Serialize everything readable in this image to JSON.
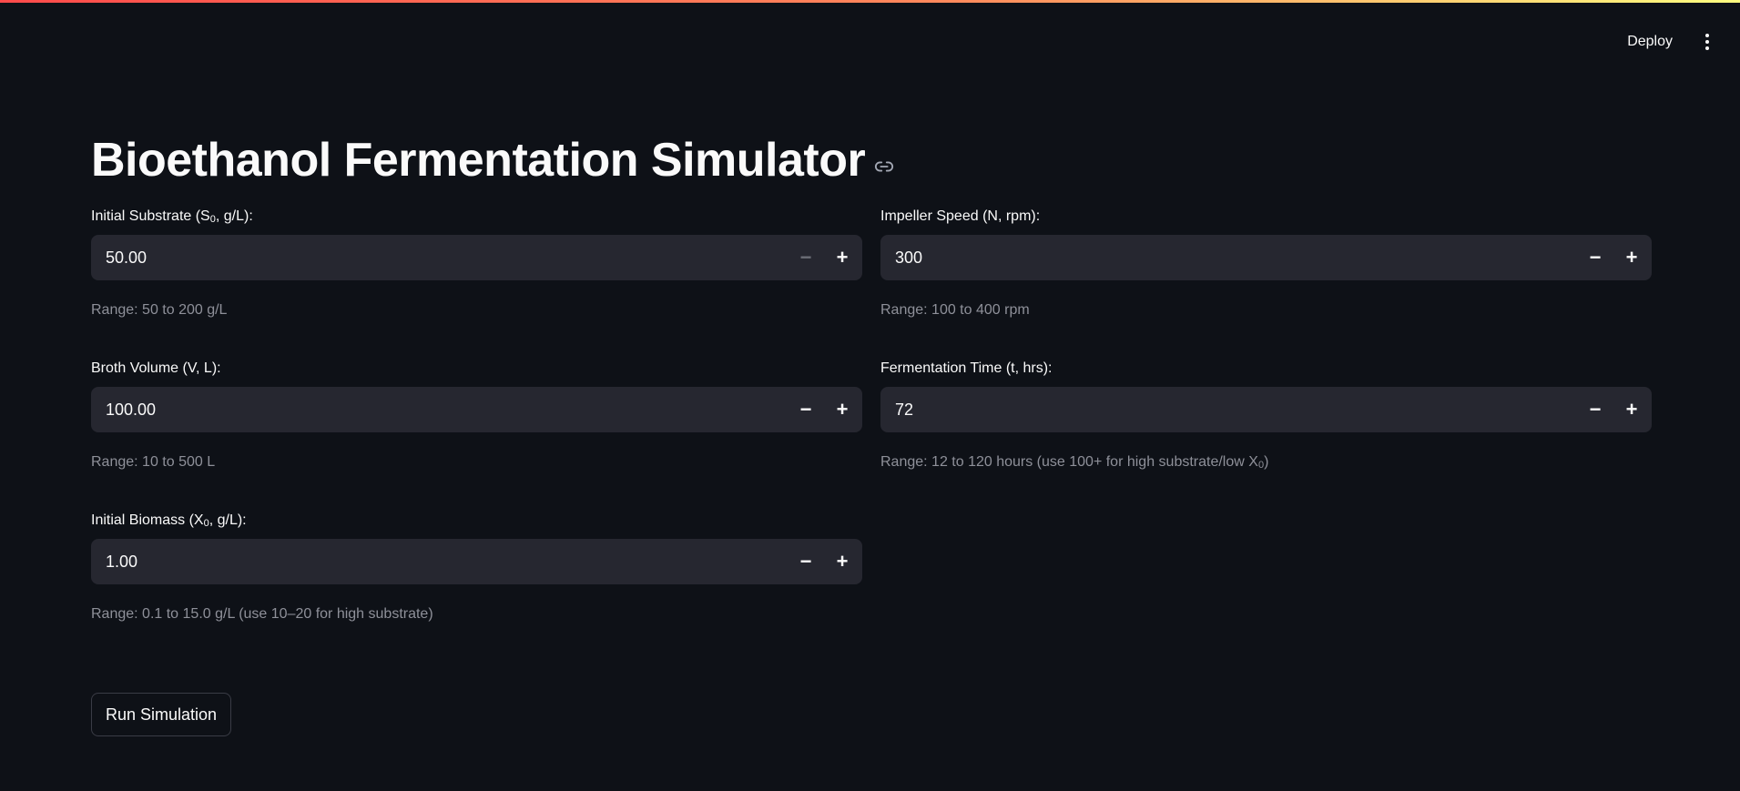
{
  "header": {
    "deploy_label": "Deploy",
    "menu_icon": "more-vertical-icon"
  },
  "page": {
    "title": "Bioethanol Fermentation Simulator",
    "title_link_icon": "link-icon"
  },
  "fields": {
    "substrate": {
      "label_prefix": "Initial Substrate (S",
      "label_sub": "0",
      "label_suffix": ", g/L):",
      "value": "50.00",
      "help": "Range: 50 to 200 g/L",
      "decrement_disabled": true
    },
    "impeller": {
      "label": "Impeller Speed (N, rpm):",
      "value": "300",
      "help": "Range: 100 to 400 rpm"
    },
    "volume": {
      "label": "Broth Volume (V, L):",
      "value": "100.00",
      "help": "Range: 10 to 500 L"
    },
    "time": {
      "label": "Fermentation Time (t, hrs):",
      "value": "72",
      "help_prefix": "Range: 12 to 120 hours (use 100+ for high substrate/low X",
      "help_sub": "0",
      "help_suffix": ")"
    },
    "biomass": {
      "label_prefix": "Initial Biomass (X",
      "label_sub": "0",
      "label_suffix": ", g/L):",
      "value": "1.00",
      "help": "Range: 0.1 to 15.0 g/L (use 10–20 for high substrate)"
    }
  },
  "stepper": {
    "minus": "−",
    "plus": "+"
  },
  "actions": {
    "run_label": "Run Simulation"
  },
  "colors": {
    "background": "#0e1117",
    "input_bg": "#262730",
    "text": "#fafafa",
    "muted": "#8e9099",
    "accent": "#ff4b4b"
  }
}
